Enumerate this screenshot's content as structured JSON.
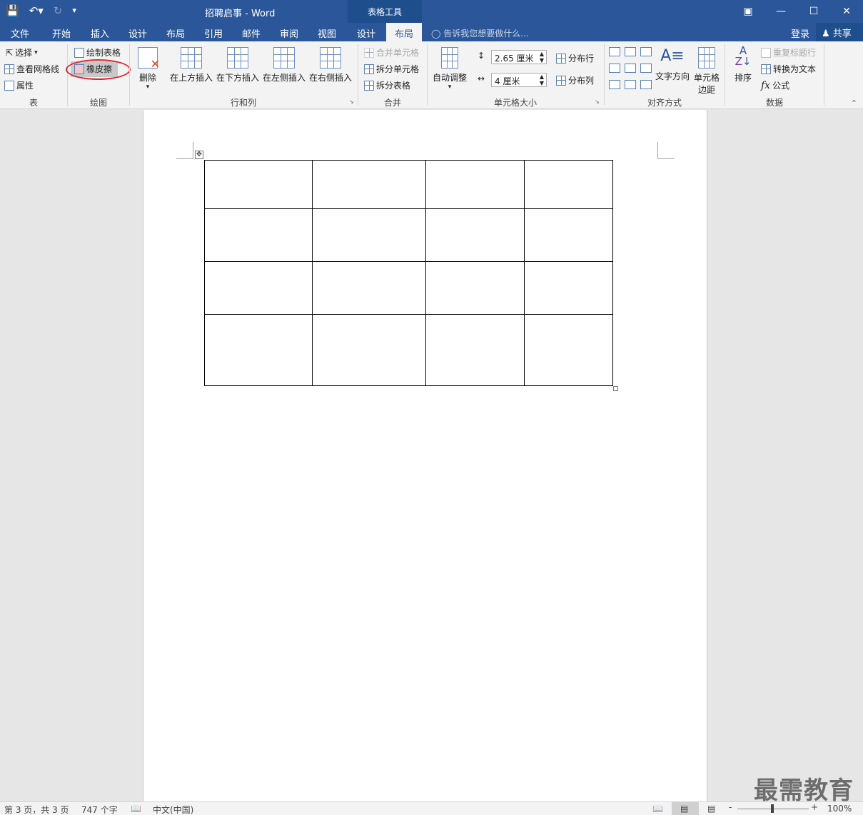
{
  "titlebar": {
    "qat": {
      "save_icon": "save-icon",
      "undo_icon": "undo-icon",
      "redo_icon": "redo-icon",
      "customize_icon": "customize-qat-icon"
    },
    "title": "招聘启事 - Word",
    "context_label": "表格工具",
    "window_buttons": [
      "restore-ribbon-icon",
      "minimize-icon",
      "maximize-icon",
      "close-icon"
    ]
  },
  "tabs": {
    "file": "文件",
    "home": "开始",
    "insert": "插入",
    "design": "设计",
    "layout": "布局",
    "references": "引用",
    "mailings": "邮件",
    "review": "审阅",
    "view": "视图",
    "table_design": "设计",
    "table_layout": "布局",
    "tell_me": "告诉我您想要做什么...",
    "login": "登录",
    "share": "共享"
  },
  "ribbon": {
    "table_group": {
      "label": "表",
      "select": "选择",
      "gridlines": "查看网格线",
      "properties": "属性"
    },
    "draw_group": {
      "label": "绘图",
      "draw_table": "绘制表格",
      "eraser": "橡皮擦"
    },
    "rows_cols_group": {
      "label": "行和列",
      "delete": "删除",
      "insert_above": "在上方插入",
      "insert_below": "在下方插入",
      "insert_left": "在左侧插入",
      "insert_right": "在右侧插入"
    },
    "merge_group": {
      "label": "合并",
      "merge_cells": "合并单元格",
      "split_cells": "拆分单元格",
      "split_table": "拆分表格"
    },
    "cell_size_group": {
      "label": "单元格大小",
      "autofit": "自动调整",
      "height": "2.65 厘米",
      "width": "4 厘米",
      "dist_rows": "分布行",
      "dist_cols": "分布列"
    },
    "alignment_group": {
      "label": "对齐方式",
      "text_direction": "文字方向",
      "cell_margins_1": "单元格",
      "cell_margins_2": "边距"
    },
    "data_group": {
      "label": "数据",
      "sort": "排序",
      "repeat_header": "重复标题行",
      "convert_to_text": "转换为文本",
      "formula": "公式"
    }
  },
  "document": {
    "table": {
      "rows": 4,
      "cols": 4,
      "cells": [
        [
          "",
          "",
          "",
          ""
        ],
        [
          "",
          "",
          "",
          ""
        ],
        [
          "",
          "",
          "",
          ""
        ],
        [
          "",
          "",
          "",
          ""
        ]
      ]
    }
  },
  "statusbar": {
    "page": "第 3 页，共 3 页",
    "words": "747 个字",
    "language": "中文(中国)",
    "zoom": "100%",
    "zoom_minus": "-",
    "zoom_plus": "+"
  },
  "watermark": "最需教育"
}
